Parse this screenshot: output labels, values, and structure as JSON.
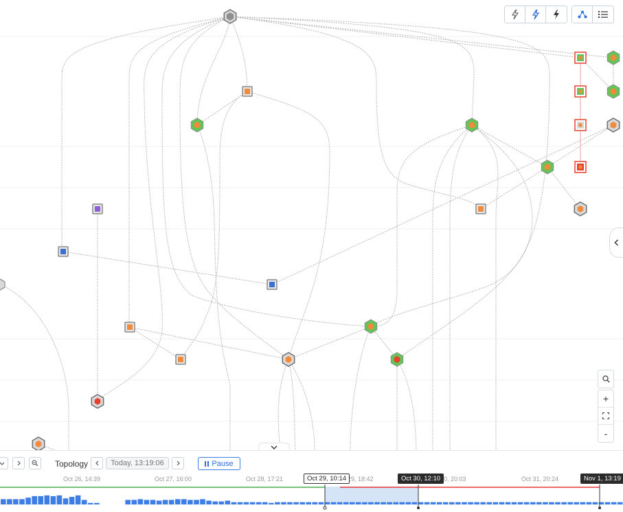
{
  "toolbar": {
    "buttons": [
      {
        "name": "lightning-outline-button",
        "icon": "lightning-outline-icon"
      },
      {
        "name": "lightning-blue-button",
        "icon": "lightning-icon"
      },
      {
        "name": "lightning-solid-button",
        "icon": "lightning-solid-icon"
      },
      {
        "name": "topology-view-button",
        "icon": "topology-icon",
        "active": true
      },
      {
        "name": "list-view-button",
        "icon": "list-icon"
      }
    ]
  },
  "zoom": {
    "search_icon": "search-icon",
    "zoom_in_label": "+",
    "fit_icon": "fit-screen-icon",
    "zoom_out_label": "-"
  },
  "bottom": {
    "view_label": "Topology",
    "current_time": "Today, 13:19:06",
    "pause_label": "Pause",
    "timeline": {
      "ticks": [
        "Oct 26, 14:39",
        "Oct 27, 16:00",
        "Oct 28, 17:21",
        "29, 18:42",
        "30, 20:03",
        "Oct 31, 20:24"
      ],
      "markers": [
        "Oct 29, 10:14",
        "Oct 30, 12:10",
        "Nov 1, 13:19"
      ]
    }
  },
  "colors": {
    "edge": "#b5b5b5",
    "node_gray": "#8f8f8f",
    "node_green": "#62c557",
    "node_orange": "#f08a3c",
    "node_red": "#e8402f",
    "node_purple": "#8f5fd6",
    "node_blue": "#3b6fd0",
    "accent": "#2f6fd8",
    "histogram": "#3d7de4",
    "selection": "#d6e4f7",
    "ok_line": "#4caf50",
    "alert_line": "#e53935"
  },
  "histogram_values": [
    0.35,
    0.35,
    0.35,
    0.35,
    0.45,
    0.55,
    0.55,
    0.6,
    0.55,
    0.6,
    0.4,
    0.5,
    0.6,
    0.3,
    0.1,
    0.1,
    0,
    0,
    0,
    0,
    0.3,
    0.3,
    0.35,
    0.3,
    0.3,
    0.25,
    0.3,
    0.3,
    0.35,
    0.35,
    0.3,
    0.3,
    0.35,
    0.25,
    0.2,
    0.2,
    0.25,
    0.15,
    0.15,
    0.15,
    0.15,
    0.15,
    0.15,
    0.1,
    0.15,
    0.15,
    0.15,
    0.15,
    0.15,
    0.15,
    0.15,
    0.15,
    0.15,
    0.15,
    0.15,
    0.15,
    0.15,
    0.15,
    0.15,
    0.15,
    0.15,
    0.15,
    0.15,
    0.15,
    0.15,
    0.15,
    0.15,
    0.15,
    0.15,
    0.15,
    0.15,
    0.15,
    0.15,
    0.15,
    0.15,
    0.15,
    0.15,
    0.15,
    0.15,
    0.15,
    0.15,
    0.15,
    0.15,
    0.15,
    0.15,
    0.15,
    0.15,
    0.15,
    0.15,
    0.15,
    0.15,
    0.15,
    0.15,
    0.15,
    0.15,
    0.15,
    0.15,
    0.15,
    0.15,
    0.15
  ]
}
